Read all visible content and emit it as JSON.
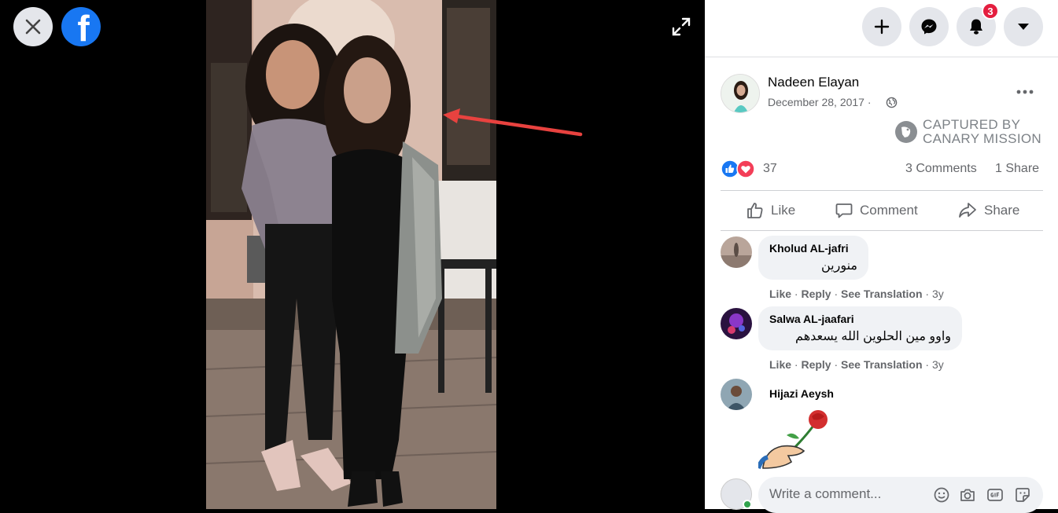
{
  "topbar": {
    "notification_count": "3"
  },
  "post": {
    "author": "Nadeen Elayan",
    "date": "December 28, 2017 ·",
    "watermark_line1": "CAPTURED BY",
    "watermark_line2": "CANARY MISSION",
    "reaction_count": "37",
    "comments_label": "3 Comments",
    "shares_label": "1 Share"
  },
  "actions": {
    "like": "Like",
    "comment": "Comment",
    "share": "Share"
  },
  "comments": [
    {
      "name": "Kholud AL-jafri",
      "text": "منورين",
      "like": "Like",
      "reply": "Reply",
      "translate": "See Translation",
      "age": "3y"
    },
    {
      "name": "Salwa AL-jaafari",
      "text": "واوو مين الحلوين الله يسعدهم",
      "like": "Like",
      "reply": "Reply",
      "translate": "See Translation",
      "age": "3y"
    },
    {
      "name": "Hijazi Aeysh"
    }
  ],
  "composer": {
    "placeholder": "Write a comment..."
  },
  "colors": {
    "brand": "#1877f2",
    "annotation_arrow": "#e8423f",
    "badge": "#e41e3f"
  }
}
